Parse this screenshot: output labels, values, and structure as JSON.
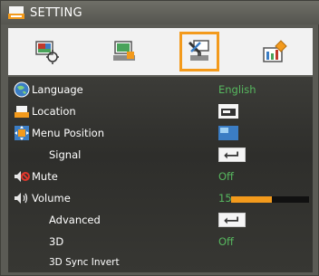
{
  "window": {
    "title": "SETTING"
  },
  "tabs": [
    {
      "icon": "image-settings-icon",
      "active": false
    },
    {
      "icon": "screen-settings-icon",
      "active": false
    },
    {
      "icon": "setting-tools-icon",
      "active": true
    },
    {
      "icon": "options-icon",
      "active": false
    }
  ],
  "menu": {
    "language": {
      "label": "Language",
      "value": "English"
    },
    "location": {
      "label": "Location"
    },
    "menu_position": {
      "label": "Menu Position"
    },
    "signal": {
      "label": "Signal"
    },
    "mute": {
      "label": "Mute",
      "value": "Off"
    },
    "volume": {
      "label": "Volume",
      "value": "15",
      "level_fraction": 0.52
    },
    "advanced": {
      "label": "Advanced"
    },
    "three_d": {
      "label": "3D",
      "value": "Off"
    },
    "sync_invert": {
      "label": "3D Sync Invert"
    }
  },
  "colors": {
    "accent": "#f39a1c",
    "value_text": "#57b85f",
    "label_text": "#ffffff"
  }
}
